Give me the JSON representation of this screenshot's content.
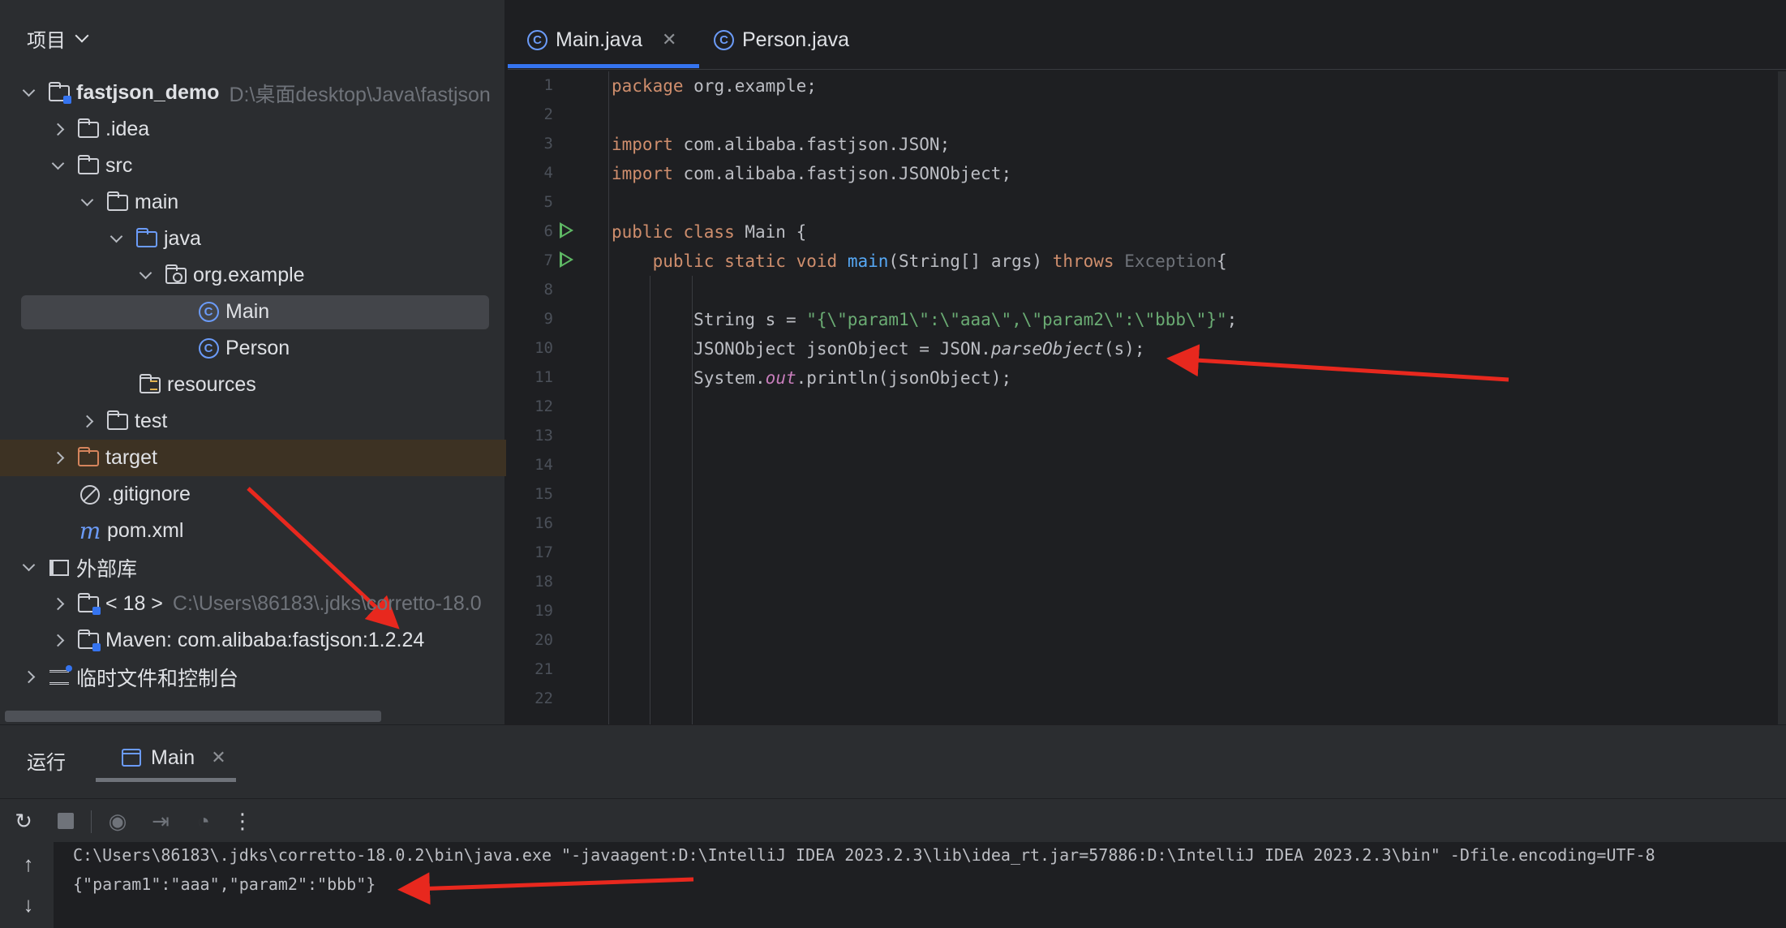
{
  "project_panel": {
    "title": "项目",
    "tree": [
      {
        "label": "fastjson_demo",
        "path": "D:\\桌面desktop\\Java\\fastjson",
        "kind": "module"
      },
      {
        "label": ".idea"
      },
      {
        "label": "src"
      },
      {
        "label": "main"
      },
      {
        "label": "java"
      },
      {
        "label": "org.example"
      },
      {
        "label": "Main"
      },
      {
        "label": "Person"
      },
      {
        "label": "resources"
      },
      {
        "label": "test"
      },
      {
        "label": "target"
      },
      {
        "label": ".gitignore"
      },
      {
        "label": "pom.xml"
      },
      {
        "label": "外部库"
      },
      {
        "label": "< 18 >",
        "path": "C:\\Users\\86183\\.jdks\\corretto-18.0"
      },
      {
        "label": "Maven: com.alibaba:fastjson:1.2.24"
      },
      {
        "label": "临时文件和控制台"
      }
    ]
  },
  "editor": {
    "tabs": [
      {
        "label": "Main.java",
        "active": true
      },
      {
        "label": "Person.java",
        "active": false
      }
    ],
    "line_numbers": [
      "1",
      "2",
      "3",
      "4",
      "5",
      "6",
      "7",
      "8",
      "9",
      "10",
      "11",
      "12",
      "13",
      "14",
      "15",
      "16",
      "17",
      "18",
      "19",
      "20",
      "21",
      "22"
    ],
    "code": {
      "l1": {
        "kw": "package",
        "rest": " org.example;"
      },
      "l3": {
        "kw": "import",
        "rest": " com.alibaba.fastjson.JSON;"
      },
      "l4": {
        "kw": "import",
        "rest": " com.alibaba.fastjson.JSONObject;"
      },
      "l6": {
        "kw": "public class",
        "rest": " Main {"
      },
      "l7": {
        "indent": "    ",
        "kw": "public static void",
        "fn": "main",
        "rest": "(String[] args) ",
        "kw2": "throws",
        "dim": " Exception",
        "end": "{"
      },
      "l9": {
        "indent": "        ",
        "pre": "String s = ",
        "str": "\"{\\\"param1\\\":\\\"aaa\\\",\\\"param2\\\":\\\"bbb\\\"}\"",
        "end": ";"
      },
      "l10": {
        "indent": "        ",
        "pre": "JSONObject jsonObject = JSON.",
        "it": "parseObject",
        "end": "(s);"
      },
      "l11": {
        "indent": "        ",
        "pre": "System.",
        "st": "out",
        "end": ".println(jsonObject);"
      }
    }
  },
  "run_panel": {
    "title": "运行",
    "tab_label": "Main",
    "output": [
      "C:\\Users\\86183\\.jdks\\corretto-18.0.2\\bin\\java.exe \"-javaagent:D:\\IntelliJ IDEA 2023.2.3\\lib\\idea_rt.jar=57886:D:\\IntelliJ IDEA 2023.2.3\\bin\" -Dfile.encoding=UTF-8",
      "{\"param1\":\"aaa\",\"param2\":\"bbb\"}"
    ]
  },
  "colors": {
    "accent": "#3574f0",
    "annotation": "#e8281e"
  }
}
